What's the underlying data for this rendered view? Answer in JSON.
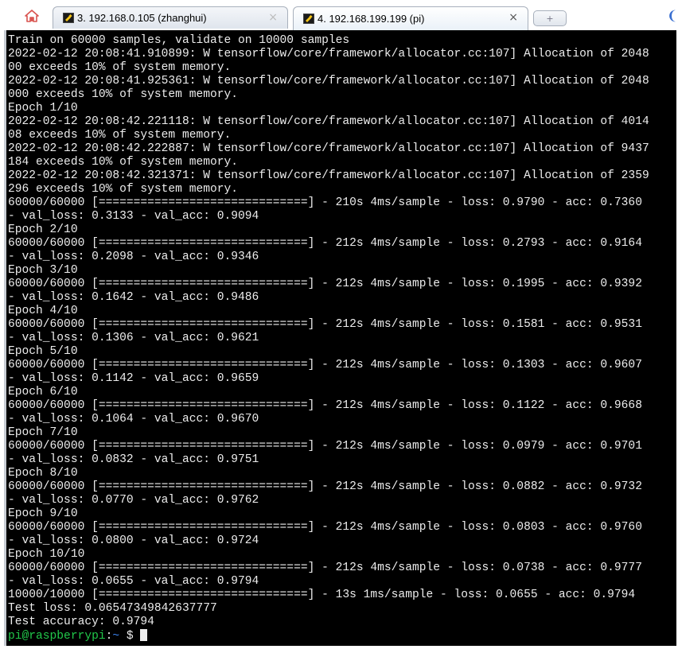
{
  "tabs": [
    {
      "title": "3. 192.168.0.105 (zhanghui)",
      "close": "×",
      "active": false
    },
    {
      "title": "4. 192.168.199.199 (pi)",
      "close": "×",
      "active": true
    }
  ],
  "new_tab": "+",
  "terminal": {
    "lines": [
      "Train on 60000 samples, validate on 10000 samples",
      "2022-02-12 20:08:41.910899: W tensorflow/core/framework/allocator.cc:107] Allocation of 2048",
      "00 exceeds 10% of system memory.",
      "2022-02-12 20:08:41.925361: W tensorflow/core/framework/allocator.cc:107] Allocation of 2048",
      "000 exceeds 10% of system memory.",
      "Epoch 1/10",
      "2022-02-12 20:08:42.221118: W tensorflow/core/framework/allocator.cc:107] Allocation of 4014",
      "08 exceeds 10% of system memory.",
      "2022-02-12 20:08:42.222887: W tensorflow/core/framework/allocator.cc:107] Allocation of 9437",
      "184 exceeds 10% of system memory.",
      "2022-02-12 20:08:42.321371: W tensorflow/core/framework/allocator.cc:107] Allocation of 2359",
      "296 exceeds 10% of system memory.",
      "60000/60000 [==============================] - 210s 4ms/sample - loss: 0.9790 - acc: 0.7360",
      "- val_loss: 0.3133 - val_acc: 0.9094",
      "Epoch 2/10",
      "60000/60000 [==============================] - 212s 4ms/sample - loss: 0.2793 - acc: 0.9164",
      "- val_loss: 0.2098 - val_acc: 0.9346",
      "Epoch 3/10",
      "60000/60000 [==============================] - 212s 4ms/sample - loss: 0.1995 - acc: 0.9392",
      "- val_loss: 0.1642 - val_acc: 0.9486",
      "Epoch 4/10",
      "60000/60000 [==============================] - 212s 4ms/sample - loss: 0.1581 - acc: 0.9531",
      "- val_loss: 0.1306 - val_acc: 0.9621",
      "Epoch 5/10",
      "60000/60000 [==============================] - 212s 4ms/sample - loss: 0.1303 - acc: 0.9607",
      "- val_loss: 0.1142 - val_acc: 0.9659",
      "Epoch 6/10",
      "60000/60000 [==============================] - 212s 4ms/sample - loss: 0.1122 - acc: 0.9668",
      "- val_loss: 0.1064 - val_acc: 0.9670",
      "Epoch 7/10",
      "60000/60000 [==============================] - 212s 4ms/sample - loss: 0.0979 - acc: 0.9701",
      "- val_loss: 0.0832 - val_acc: 0.9751",
      "Epoch 8/10",
      "60000/60000 [==============================] - 212s 4ms/sample - loss: 0.0882 - acc: 0.9732",
      "- val_loss: 0.0770 - val_acc: 0.9762",
      "Epoch 9/10",
      "60000/60000 [==============================] - 212s 4ms/sample - loss: 0.0803 - acc: 0.9760",
      "- val_loss: 0.0800 - val_acc: 0.9724",
      "Epoch 10/10",
      "60000/60000 [==============================] - 212s 4ms/sample - loss: 0.0738 - acc: 0.9777",
      "- val_loss: 0.0655 - val_acc: 0.9794",
      "10000/10000 [==============================] - 13s 1ms/sample - loss: 0.0655 - acc: 0.9794",
      "Test loss: 0.06547349842637777",
      "Test accuracy: 0.9794"
    ],
    "prompt": {
      "user_host": "pi@raspberrypi",
      "colon": ":",
      "path": "~",
      "sign": " $ "
    }
  },
  "colors": {
    "terminal_bg": "#000000",
    "terminal_text": "#ededed",
    "prompt_user": "#21c84a",
    "prompt_path": "#3d86f5"
  },
  "icons": {
    "home": "home-icon",
    "terminal_tab": "terminal-tab-icon"
  }
}
